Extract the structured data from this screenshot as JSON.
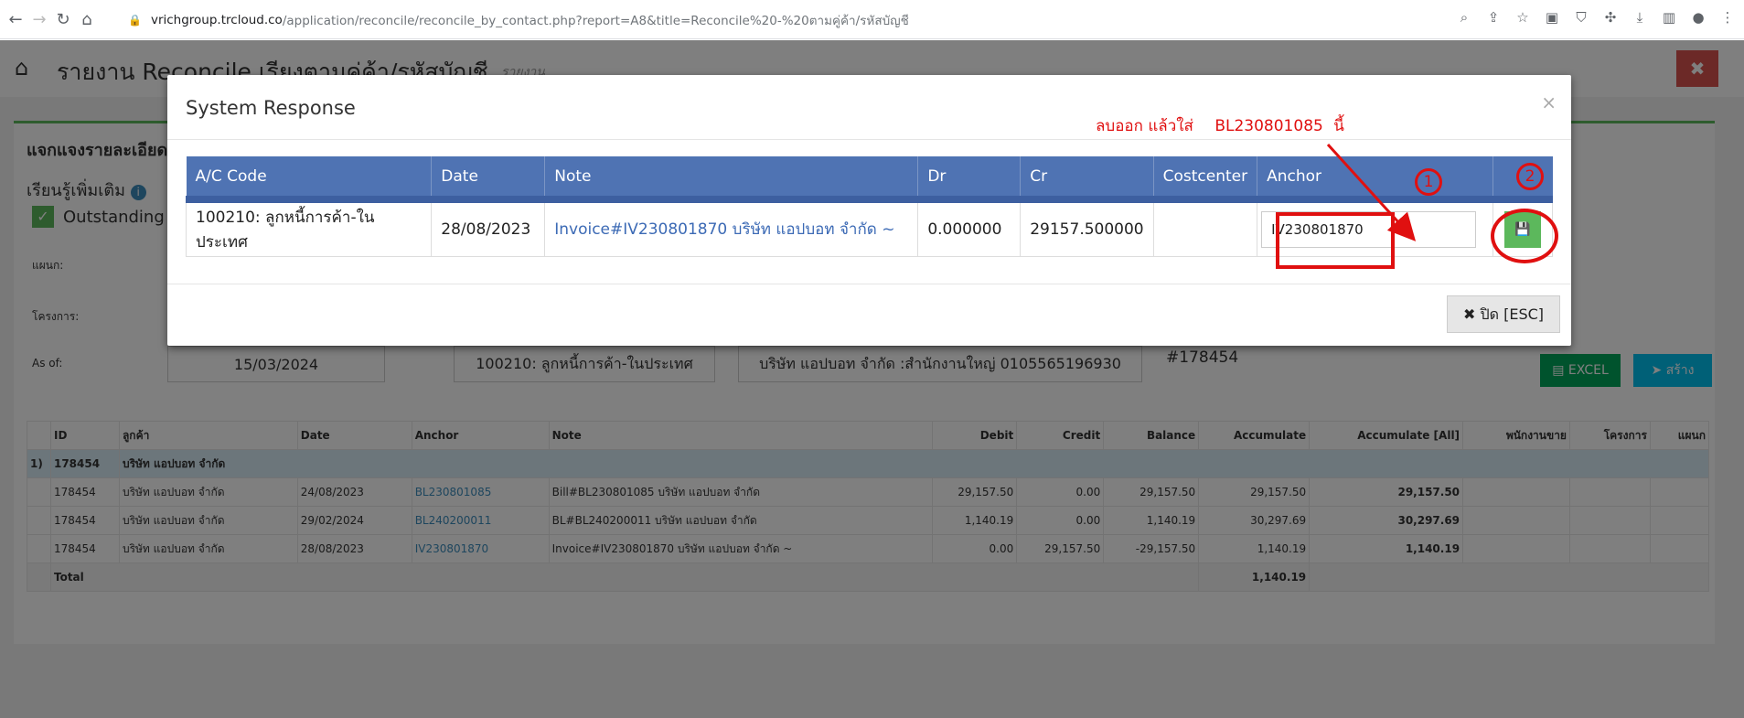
{
  "browser": {
    "url_host": "vrichgroup.trcloud.co",
    "url_path": "/application/reconcile/reconcile_by_contact.php?report=A8&title=Reconcile%20-%20ตามคู่ค้า/รหัสบัญชี"
  },
  "page": {
    "title": "รายงาน Reconcile เรียงตามคู่ค้า/รหัสบัญชี",
    "subtitle": "รายงาน",
    "panel_title": "แจกแจงรายละเอียด",
    "learn_more": "เรียนรู้เพิ่มเติม",
    "outstanding_label": "Outstanding",
    "dept_label": "แผนก:",
    "project_label": "โครงการ:",
    "asof_label": "As of:",
    "asof_value": "15/03/2024",
    "account_value": "100210: ลูกหนี้การค้า-ในประเทศ",
    "contact_value": "บริษัท แอปบอท จำกัด :สำนักงานใหญ่ 0105565196930",
    "doc_number": "#178454",
    "excel_label": "EXCEL",
    "create_label": "สร้าง"
  },
  "report": {
    "headers": [
      "",
      "ID",
      "ลูกค้า",
      "Date",
      "Anchor",
      "Note",
      "Debit",
      "Credit",
      "Balance",
      "Accumulate",
      "Accumulate [All]",
      "พนักงานขาย",
      "โครงการ",
      "แผนก"
    ],
    "group": {
      "index": "1)",
      "id": "178454",
      "name": "บริษัท แอปบอท จำกัด"
    },
    "rows": [
      {
        "id": "178454",
        "customer": "บริษัท แอปบอท จำกัด",
        "date": "24/08/2023",
        "anchor": "BL230801085",
        "note": "Bill#BL230801085 บริษัท แอปบอท จำกัด",
        "debit": "29,157.50",
        "credit": "0.00",
        "balance": "29,157.50",
        "accumulate": "29,157.50",
        "accumulate_all": "29,157.50"
      },
      {
        "id": "178454",
        "customer": "บริษัท แอปบอท จำกัด",
        "date": "29/02/2024",
        "anchor": "BL240200011",
        "note": "BL#BL240200011 บริษัท แอปบอท จำกัด",
        "debit": "1,140.19",
        "credit": "0.00",
        "balance": "1,140.19",
        "accumulate": "30,297.69",
        "accumulate_all": "30,297.69"
      },
      {
        "id": "178454",
        "customer": "บริษัท แอปบอท จำกัด",
        "date": "28/08/2023",
        "anchor": "IV230801870",
        "note": "Invoice#IV230801870 บริษัท แอปบอท จำกัด ~",
        "debit": "0.00",
        "credit": "29,157.50",
        "balance": "-29,157.50",
        "accumulate": "1,140.19",
        "accumulate_all": "1,140.19"
      }
    ],
    "total_label": "Total",
    "total_accumulate": "1,140.19"
  },
  "modal": {
    "title": "System Response",
    "headers": [
      "A/C Code",
      "Date",
      "Note",
      "Dr",
      "Cr",
      "Costcenter",
      "Anchor",
      ""
    ],
    "row": {
      "ac_code": "100210: ลูกหนี้การค้า-ในประเทศ",
      "date": "28/08/2023",
      "note": "Invoice#IV230801870 บริษัท แอปบอท จำกัด ~",
      "dr": "0.000000",
      "cr": "29157.500000",
      "costcenter": "",
      "anchor": "IV230801870"
    },
    "close_label": "ปิด [ESC]"
  },
  "annotations": {
    "instruction": "ลบออก แล้วใส่",
    "target_anchor": "BL230801085",
    "instruction_suffix": "นี้",
    "step1": "1",
    "step2": "2"
  },
  "colors": {
    "modal_header": "#4f73b3",
    "annotation": "#e01010",
    "save_button": "#5cb85c",
    "close_top": "#d9534f"
  }
}
